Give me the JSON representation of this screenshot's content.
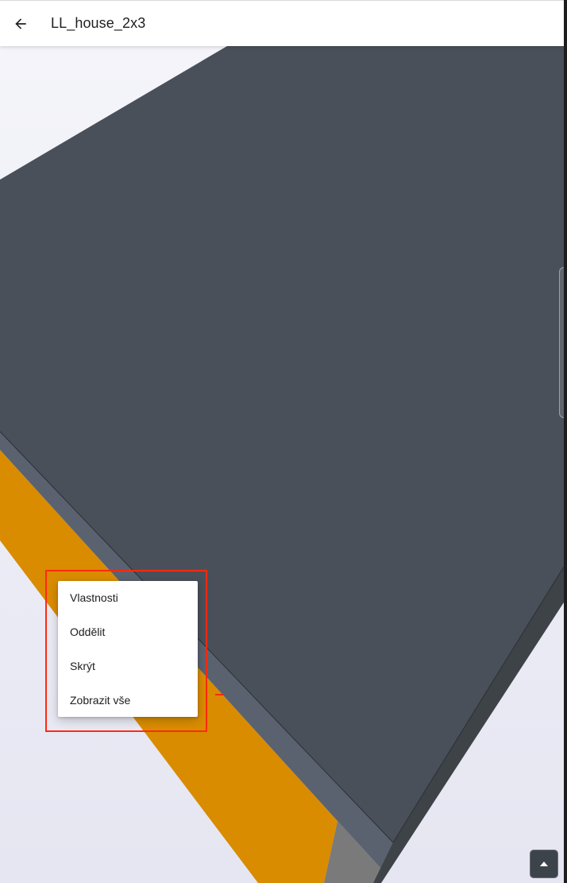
{
  "app_bar": {
    "title": "LL_house_2x3",
    "back_icon": "arrow-left-icon"
  },
  "context_menu": {
    "items": [
      {
        "label": "Vlastnosti"
      },
      {
        "label": "Oddělit"
      },
      {
        "label": "Skrýt"
      },
      {
        "label": "Zobrazit vše"
      }
    ]
  },
  "fab": {
    "icon": "caret-up-icon"
  },
  "colors": {
    "roof": "#4a505a",
    "wall": "#d98c00",
    "highlight": "#ff2a10",
    "background": "#eeeef5"
  }
}
